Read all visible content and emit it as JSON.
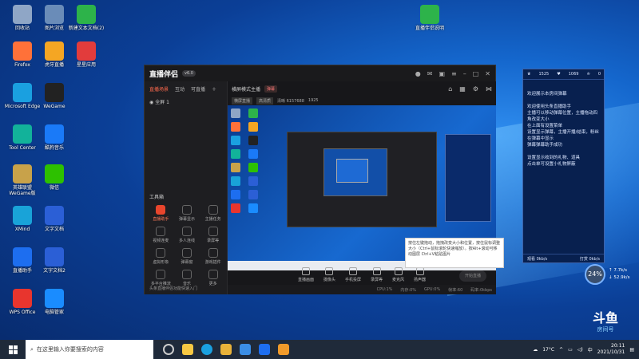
{
  "desktop": {
    "icons": [
      {
        "label": "回收站",
        "icon": "recycle-bin-icon",
        "color": "#8fa6c6"
      },
      {
        "label": "图片浏览",
        "icon": "photo-app-icon",
        "color": "#6a8cb8"
      },
      {
        "label": "新建文本文档(2)",
        "icon": "text-doc-icon",
        "color": "#2db34a"
      },
      {
        "label": "Firefox",
        "icon": "firefox-icon",
        "color": "#ff7139"
      },
      {
        "label": "虎牙直播",
        "icon": "huya-icon",
        "color": "#f5a623"
      },
      {
        "label": "星星应用",
        "icon": "star-app-icon",
        "color": "#e23c3c"
      },
      {
        "label": "Microsoft Edge",
        "icon": "edge-icon",
        "color": "#1aa0e0"
      },
      {
        "label": "WeGame",
        "icon": "wegame-icon",
        "color": "#222"
      },
      {
        "label": "Tool Center",
        "icon": "tool-icon",
        "color": "#12b29a"
      },
      {
        "label": "酷狗音乐",
        "icon": "kugou-icon",
        "color": "#1a7af8"
      },
      {
        "label": "英雄联盟WeGame版",
        "icon": "lol-icon",
        "color": "#c8a24a"
      },
      {
        "label": "微信",
        "icon": "wechat-icon",
        "color": "#2dc100"
      },
      {
        "label": "XMind",
        "icon": "xmind-icon",
        "color": "#19a3d8"
      },
      {
        "label": "文字文档",
        "icon": "word-doc-icon",
        "color": "#2b5fd6"
      },
      {
        "label": "直播助手",
        "icon": "stream-helper-icon",
        "color": "#1d6ef0"
      },
      {
        "label": "文字文档2",
        "icon": "word-doc2-icon",
        "color": "#2b5fd6"
      },
      {
        "label": "WPS Office",
        "icon": "wps-icon",
        "color": "#e8352e"
      },
      {
        "label": "电脑管家",
        "icon": "pcmgr-icon",
        "color": "#1a8cff"
      },
      {
        "label": "直播伴侣说明",
        "icon": "doc-green-icon",
        "color": "#2db34a"
      }
    ]
  },
  "app": {
    "title": "直播伴侣",
    "badge": "v6.0",
    "tabs": [
      "直播场景",
      "互动",
      "可直播"
    ],
    "active_tab": "直播场景",
    "scene": "全屏 1",
    "tools_title": "工具箱",
    "tools": [
      {
        "label": "直播助手",
        "hot": true
      },
      {
        "label": "弹幕显示"
      },
      {
        "label": "主播任务"
      },
      {
        "label": "视频连麦"
      },
      {
        "label": "多人连线"
      },
      {
        "label": "录屏等"
      },
      {
        "label": "虚拟形象"
      },
      {
        "label": "弹幕窗"
      },
      {
        "label": "游戏插件"
      },
      {
        "label": "多平台推流"
      },
      {
        "label": "音乐"
      },
      {
        "label": "更多"
      }
    ],
    "left_footer": "头条直播伴侣功能快速入门",
    "main_title": "横屏模式主播",
    "main_chip": "弹幕",
    "mode_chip": "横屏直播",
    "mode_chip2": "高清质",
    "info1": "清晰 6157688",
    "info2": "1925",
    "toolbar": [
      {
        "label": "直播画面"
      },
      {
        "label": "摄像头"
      },
      {
        "label": "手机投屏"
      },
      {
        "label": "录屏等"
      },
      {
        "label": "麦克风"
      },
      {
        "label": "扬声器"
      }
    ],
    "start_label": "开始直播",
    "status": [
      "CPU:1%",
      "内存:0%",
      "GPU:0%",
      "帧率:60",
      "码率:0kbps"
    ],
    "tooltip": "按住左键拖动，拖拽改变大小和位置，按住鼠标调整大小（Ctrl+鼠标滚轮快速缩放）。按Alt+滚动可移动图层 Ctrl+V粘贴图片"
  },
  "chat": {
    "header": [
      "1525",
      "1069",
      "0"
    ],
    "lines": [
      "欢迎展示本房间弹幕",
      "欢迎使用头条直播助手",
      "主播可以移动弹幕位置，主播拖动四角改变大小",
      "在上面有设置菜单",
      "设置显示弹幕，主播开播/结束，粉丝在弹幕中显示",
      "弹幕弹幕助手成功",
      "设置显示收到的礼物、道具",
      "点击单可设置小礼物屏蔽"
    ],
    "footer": [
      "观看 0kb/s",
      "打赏 0kb/s"
    ]
  },
  "speed": {
    "percent": "24%",
    "up": "7.7k/s",
    "down": "52.9k/s"
  },
  "watermark": {
    "line1": "斗鱼",
    "line2": "房间号"
  },
  "taskbar": {
    "search_placeholder": "在这里输入你要搜索的内容",
    "temp": "17°C",
    "time": "20:11",
    "date": "2021/10/31",
    "lang": "中"
  }
}
